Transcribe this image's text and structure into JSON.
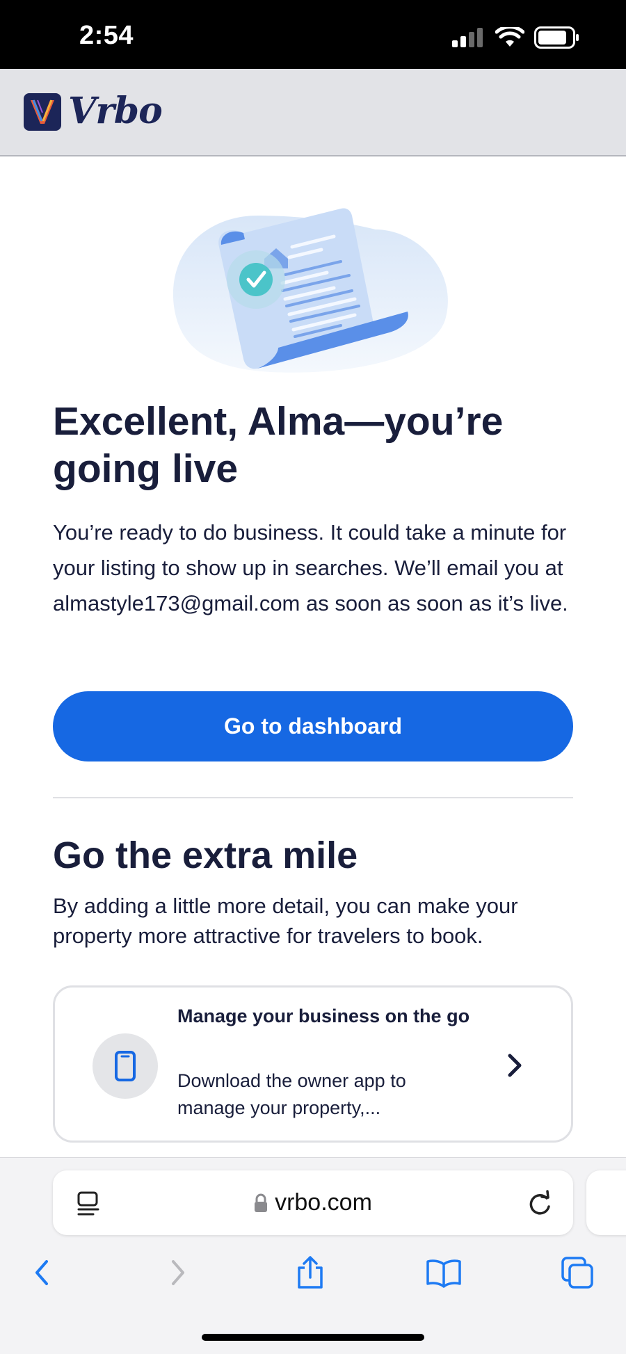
{
  "status_bar": {
    "time": "2:54"
  },
  "header": {
    "brand": "Vrbo",
    "brand_word": "Vrbo"
  },
  "main": {
    "headline": "Excellent, Alma—you’re going live",
    "body": "You’re ready to do business. It could take a minute for your listing to show up in searches. We’ll email you at almastyle173@gmail.com as soon as soon as it’s live.",
    "primary_button": "Go to dashboard"
  },
  "extra": {
    "title": "Go the extra mile",
    "subtitle": "By adding a little more detail, you can make your property more attractive for travelers to book.",
    "card": {
      "title": "Manage your business on the go",
      "description": "Download the owner app to manage your property,...",
      "icon": "phone-icon"
    }
  },
  "browser": {
    "url": "vrbo.com",
    "icons": [
      "reader-icon",
      "lock-icon",
      "reload-icon",
      "back-icon",
      "forward-icon",
      "share-icon",
      "bookmarks-icon",
      "tabs-icon"
    ]
  },
  "colors": {
    "accent": "#1668e3",
    "text": "#191e3b",
    "brand_navy": "#1c2558",
    "check_teal": "#4bc4c9"
  }
}
